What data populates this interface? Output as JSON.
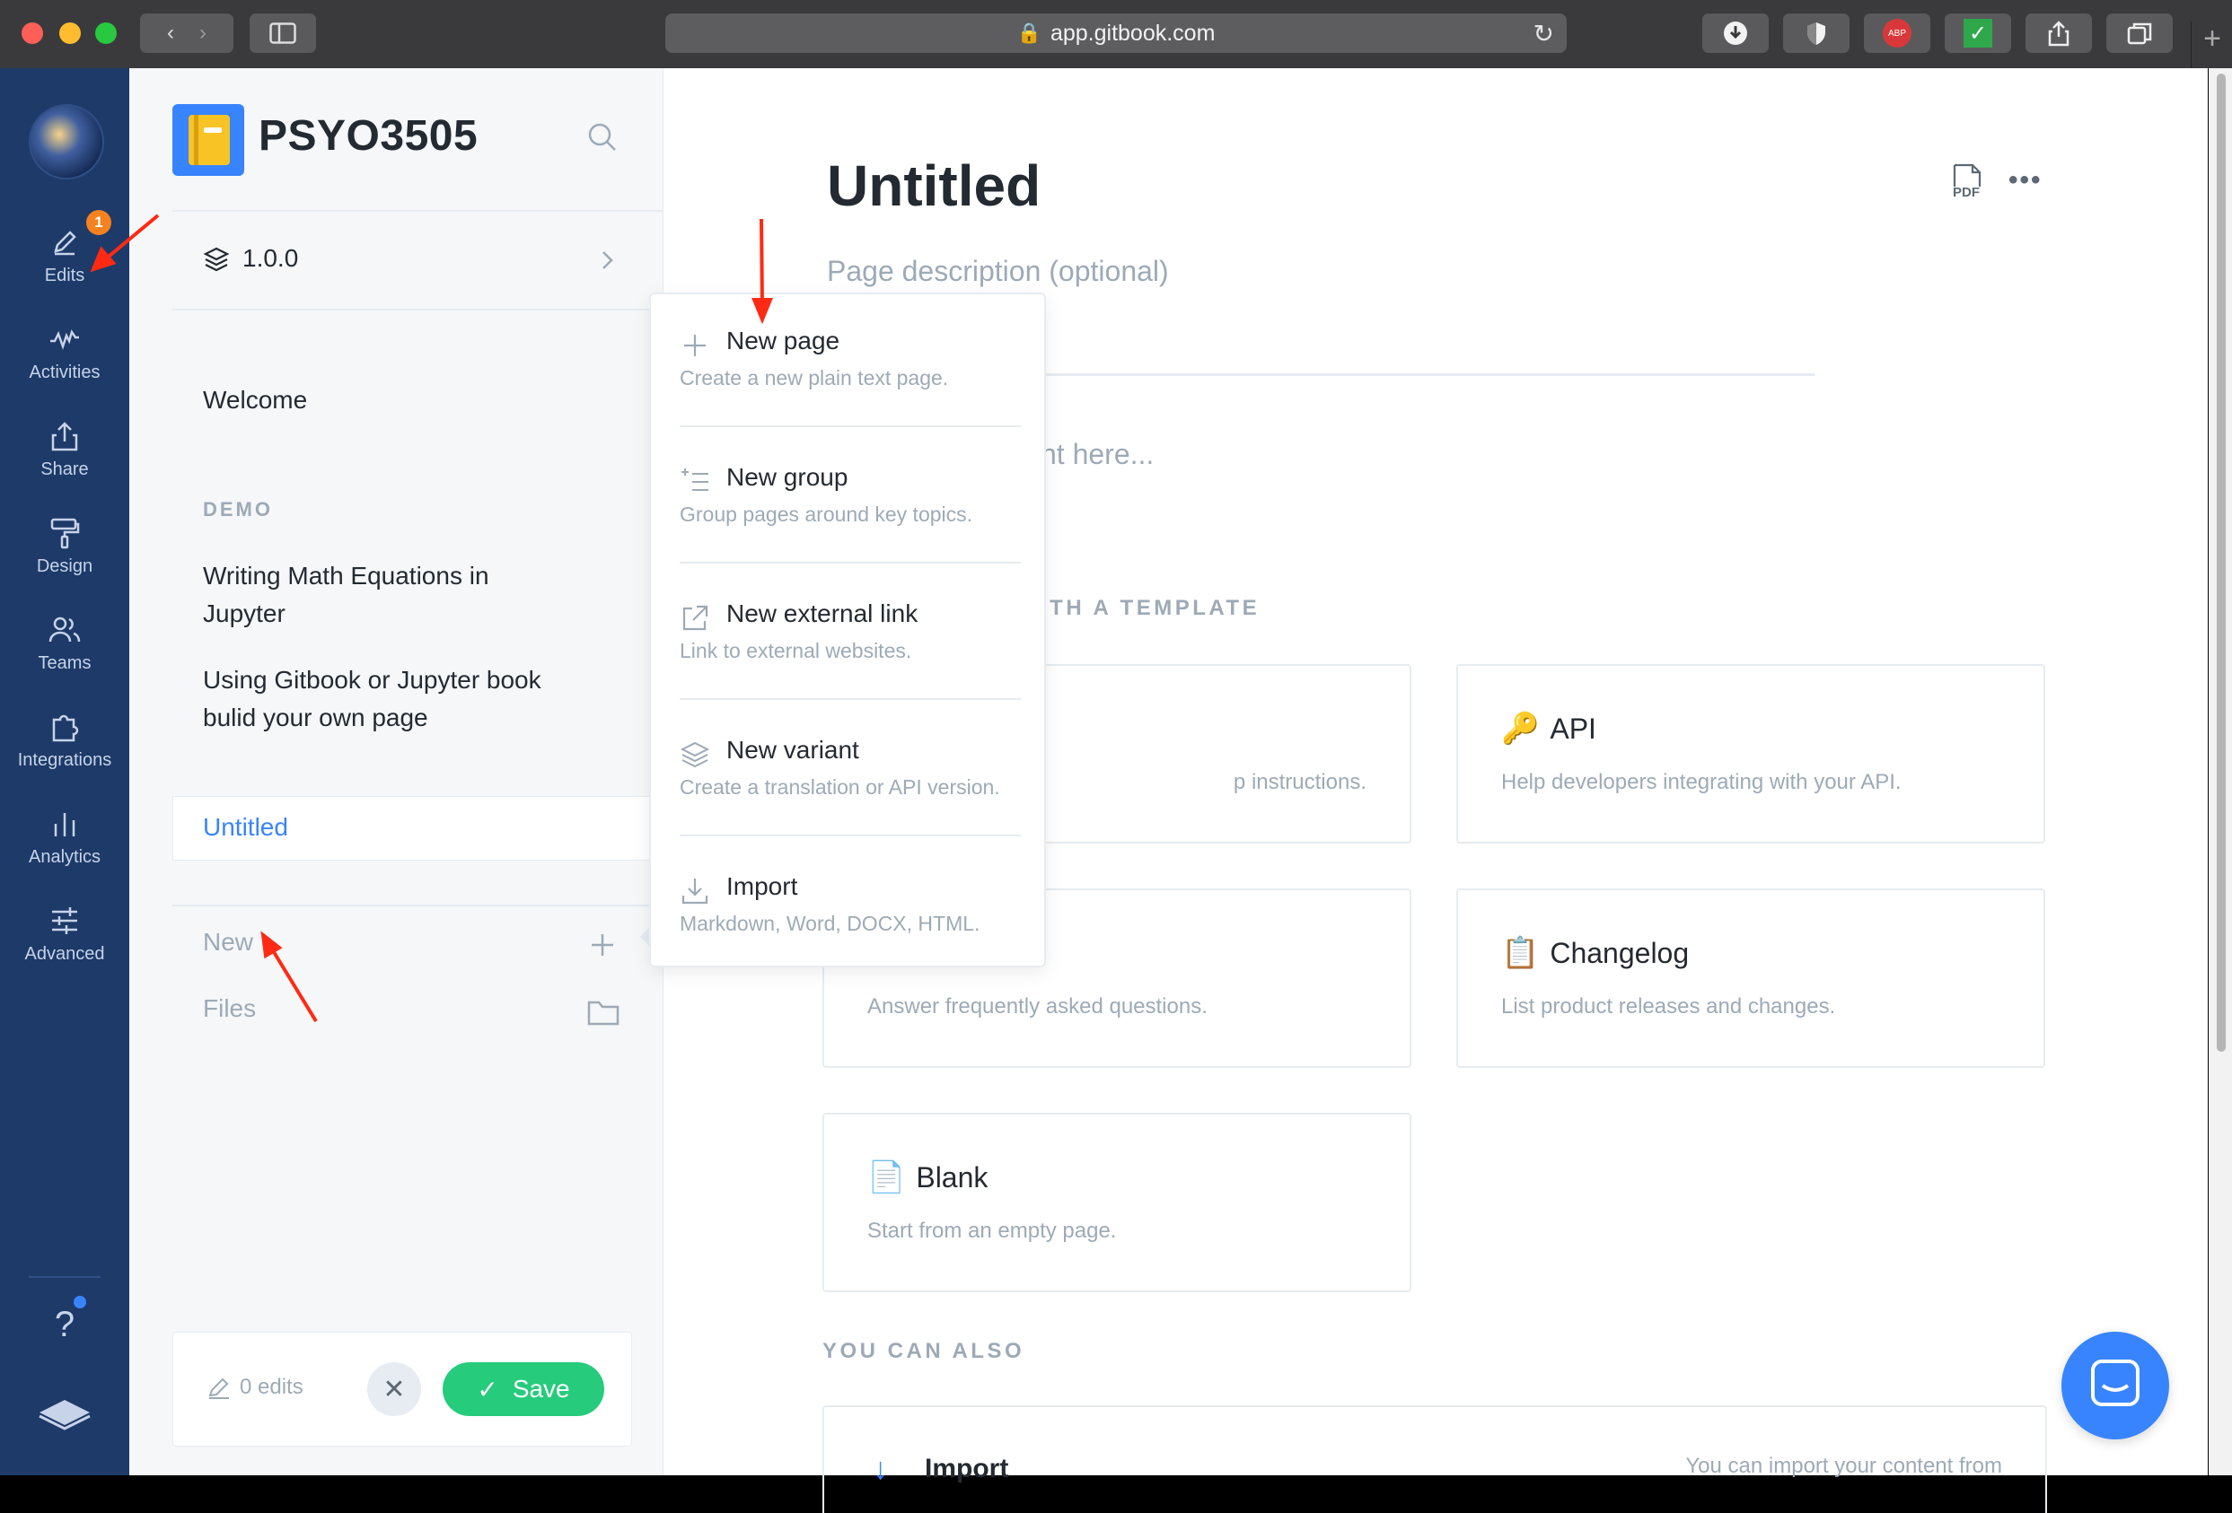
{
  "browser": {
    "url": "app.gitbook.com",
    "traffic_colors": [
      "#ff5f57",
      "#febc2e",
      "#28c840"
    ]
  },
  "rail": {
    "edits_badge": "1",
    "items": [
      {
        "label": "Edits",
        "icon": "pencil-icon"
      },
      {
        "label": "Activities",
        "icon": "activity-icon"
      },
      {
        "label": "Share",
        "icon": "share-icon"
      },
      {
        "label": "Design",
        "icon": "paint-roller-icon"
      },
      {
        "label": "Teams",
        "icon": "users-icon"
      },
      {
        "label": "Integrations",
        "icon": "puzzle-icon"
      },
      {
        "label": "Analytics",
        "icon": "bar-chart-icon"
      },
      {
        "label": "Advanced",
        "icon": "sliders-icon"
      }
    ],
    "help_label": "?"
  },
  "sidebar": {
    "space_title": "PSYO3505",
    "version": "1.0.0",
    "pages": {
      "welcome": "Welcome",
      "section": "DEMO",
      "item1_line1": "Writing Math Equations in",
      "item1_line2": "Jupyter",
      "item2_line1": "Using Gitbook or Jupyter book",
      "item2_line2": "bulid your own page",
      "active": "Untitled"
    },
    "new_label": "New",
    "files_label": "Files",
    "edits_count": "0 edits",
    "save_label": "Save"
  },
  "content": {
    "title": "Untitled",
    "description_placeholder": "Page description (optional)",
    "body_placeholder_visible": "nt here...",
    "templates_heading_visible": "ITH A TEMPLATE",
    "templates": [
      {
        "title": "",
        "desc": "p instructions."
      },
      {
        "title": "API",
        "emoji": "🔑",
        "desc": "Help developers integrating with your API."
      },
      {
        "title": "",
        "desc": "Answer frequently asked questions."
      },
      {
        "title": "Changelog",
        "emoji": "📋",
        "desc": "List product releases and changes."
      },
      {
        "title": "Blank",
        "emoji": "📄",
        "desc": "Start from an empty page."
      }
    ],
    "also_heading": "YOU CAN ALSO",
    "import_title": "Import",
    "import_right": "You can import your content from",
    "pdf_label": "PDF"
  },
  "new_menu": {
    "items": [
      {
        "title": "New page",
        "desc": "Create a new plain text page.",
        "icon": "plus-icon"
      },
      {
        "title": "New group",
        "desc": "Group pages around key topics.",
        "icon": "group-icon"
      },
      {
        "title": "New external link",
        "desc": "Link to external websites.",
        "icon": "external-link-icon"
      },
      {
        "title": "New variant",
        "desc": "Create a translation or API version.",
        "icon": "layers-icon"
      },
      {
        "title": "Import",
        "desc": "Markdown, Word, DOCX, HTML.",
        "icon": "download-icon"
      }
    ]
  },
  "colors": {
    "rail_bg": "#1d3a69",
    "accent": "#3884ff",
    "save_green": "#26cb7c",
    "annotation_red": "#ff2a14"
  }
}
